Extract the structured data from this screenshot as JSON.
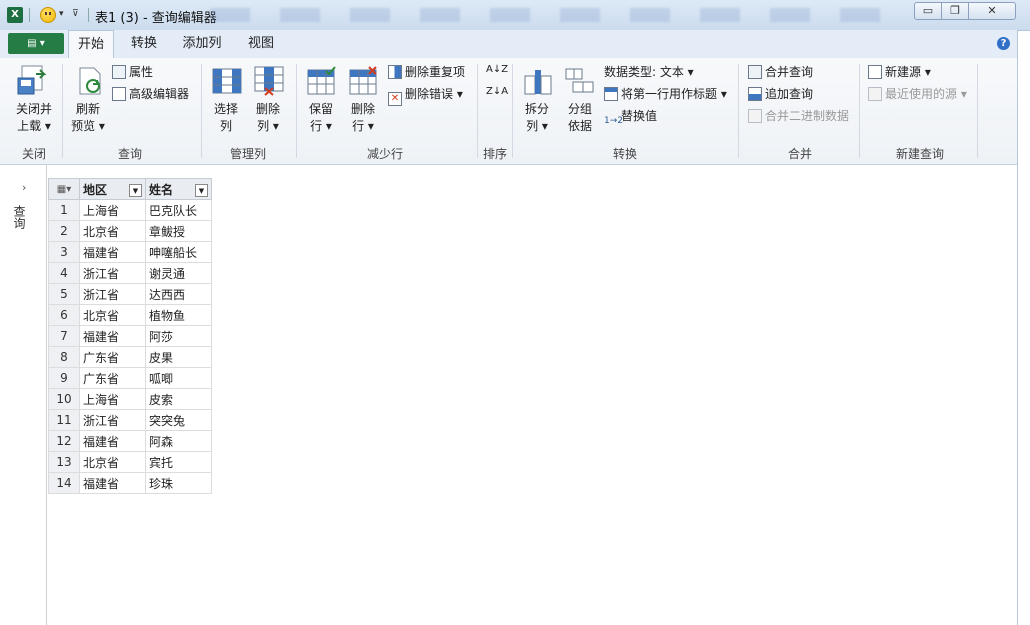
{
  "window": {
    "title": "表1 (3) - 查询编辑器",
    "minimize": "▭",
    "maximize": "❐",
    "close": "✕"
  },
  "tabs": [
    "开始",
    "转换",
    "添加列",
    "视图"
  ],
  "help": "?",
  "ribbon": {
    "groups": {
      "close": "关闭",
      "query": "查询",
      "manage_cols": "管理列",
      "reduce_rows": "减少行",
      "sort": "排序",
      "transform": "转换",
      "combine": "合并",
      "new_query": "新建查询"
    },
    "close_load": [
      "关闭并",
      "上载 ▾"
    ],
    "refresh_preview": [
      "刷新",
      "预览 ▾"
    ],
    "properties": "属性",
    "advanced_editor": "高级编辑器",
    "choose_cols": [
      "选择",
      "列"
    ],
    "remove_cols": [
      "删除",
      "列 ▾"
    ],
    "keep_rows": [
      "保留",
      "行 ▾"
    ],
    "remove_rows": [
      "删除",
      "行 ▾"
    ],
    "remove_duplicates": "删除重复项",
    "remove_errors": "删除错误 ▾",
    "sort_asc": "A↓Z",
    "sort_desc": "Z↓A",
    "split_col": [
      "拆分",
      "列 ▾"
    ],
    "group_by": [
      "分组",
      "依据"
    ],
    "data_type": "数据类型: 文本 ▾",
    "first_row_header": "将第一行用作标题 ▾",
    "replace_values": "替换值",
    "merge_queries": "合并查询",
    "append_queries": "追加查询",
    "combine_binaries": "合并二进制数据",
    "new_source": "新建源 ▾",
    "recent_sources": "最近使用的源 ▾"
  },
  "navigator": {
    "arrow": "›",
    "label": "查询"
  },
  "table": {
    "columns": [
      "地区",
      "姓名"
    ],
    "rows": [
      [
        "1",
        "上海省",
        "巴克队长"
      ],
      [
        "2",
        "北京省",
        "章鲅授"
      ],
      [
        "3",
        "福建省",
        "呻噻船长"
      ],
      [
        "4",
        "浙江省",
        "谢灵通"
      ],
      [
        "5",
        "浙江省",
        "达西西"
      ],
      [
        "6",
        "北京省",
        "植物鱼"
      ],
      [
        "7",
        "福建省",
        "阿莎"
      ],
      [
        "8",
        "广东省",
        "皮果"
      ],
      [
        "9",
        "广东省",
        "呱唧"
      ],
      [
        "10",
        "上海省",
        "皮索"
      ],
      [
        "11",
        "浙江省",
        "突突兔"
      ],
      [
        "12",
        "福建省",
        "阿森"
      ],
      [
        "13",
        "北京省",
        "宾托"
      ],
      [
        "14",
        "福建省",
        "珍珠"
      ]
    ]
  },
  "colors": {
    "accent": "#257c45",
    "ribbon_bg": "#f3f6f9",
    "titlebar": "#d6e4f3"
  }
}
